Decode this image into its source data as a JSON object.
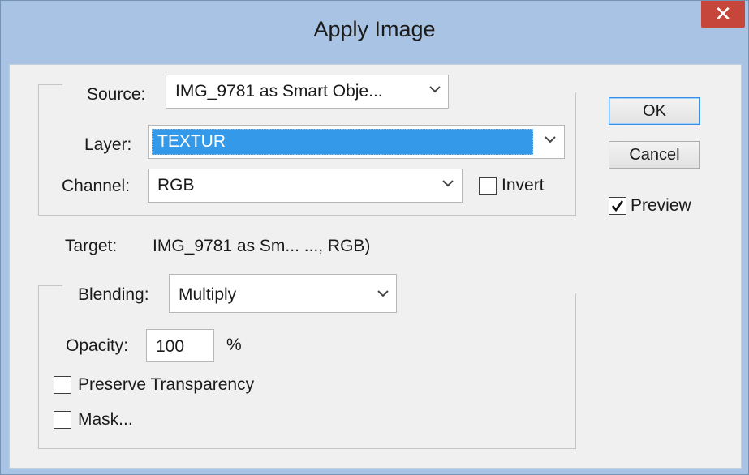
{
  "dialog": {
    "title": "Apply Image",
    "close_glyph": "✕"
  },
  "source_group": {
    "source_label": "Source:",
    "source_value": "IMG_9781 as Smart Obje...",
    "layer_label": "Layer:",
    "layer_value": "TEXTUR",
    "channel_label": "Channel:",
    "channel_value": "RGB",
    "invert_label": "Invert",
    "invert_checked": false
  },
  "target": {
    "label": "Target:",
    "value": "IMG_9781 as Sm... ..., RGB)"
  },
  "blending_group": {
    "blending_label": "Blending:",
    "blending_value": "Multiply",
    "opacity_label": "Opacity:",
    "opacity_value": "100",
    "opacity_unit": "%",
    "preserve_transparency_label": "Preserve Transparency",
    "preserve_transparency_checked": false,
    "mask_label": "Mask...",
    "mask_checked": false
  },
  "buttons": {
    "ok_label": "OK",
    "cancel_label": "Cancel"
  },
  "preview": {
    "label": "Preview",
    "checked": true
  },
  "colors": {
    "titlebar": "#a8c3e3",
    "close_button": "#c7463c",
    "dialog_background": "#f0f0f0",
    "selection_highlight": "#3399e8",
    "default_button_border": "#3a8ee6"
  },
  "icons": {
    "dropdown": "chevron-down-icon",
    "checkmark": "checkmark-icon",
    "close": "close-icon"
  }
}
